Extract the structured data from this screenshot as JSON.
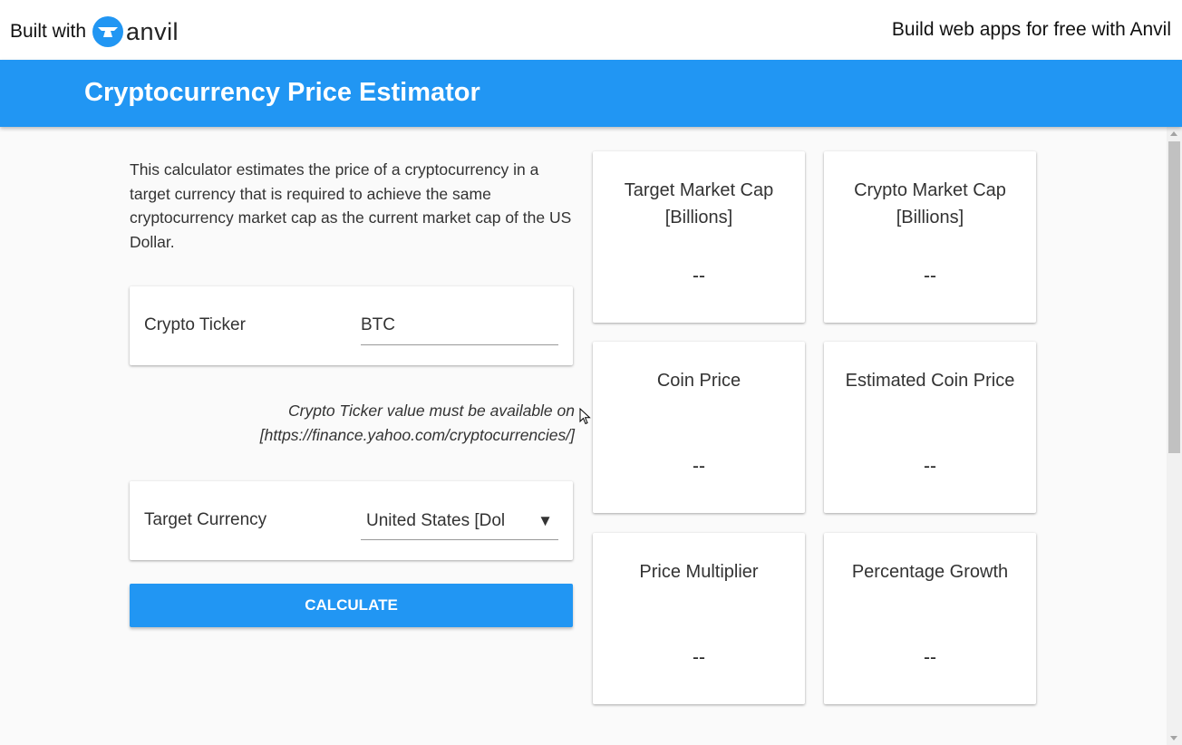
{
  "topbar": {
    "built_with": "Built with",
    "brand": "anvil",
    "promo": "Build web apps for free with Anvil"
  },
  "app": {
    "title": "Cryptocurrency Price Estimator",
    "accent_color": "#2196f3"
  },
  "description": "This calculator estimates the price of a cryptocurrency in a target currency that is required to achieve the same cryptocurrency market cap as the current market cap of the US Dollar.",
  "crypto_ticker": {
    "label": "Crypto Ticker",
    "value": "BTC"
  },
  "hint": "Crypto Ticker value must be available on [https://finance.yahoo.com/cryptocurrencies/]",
  "target_currency": {
    "label": "Target Currency",
    "selected": "United States [Dol"
  },
  "calculate_label": "CALCULATE",
  "stats": [
    {
      "label": "Target Market Cap [Billions]",
      "value": "--"
    },
    {
      "label": "Crypto Market Cap [Billions]",
      "value": "--"
    },
    {
      "label": "Coin Price",
      "value": "--"
    },
    {
      "label": "Estimated Coin Price",
      "value": "--"
    },
    {
      "label": "Price Multiplier",
      "value": "--"
    },
    {
      "label": "Percentage Growth",
      "value": "--"
    }
  ]
}
